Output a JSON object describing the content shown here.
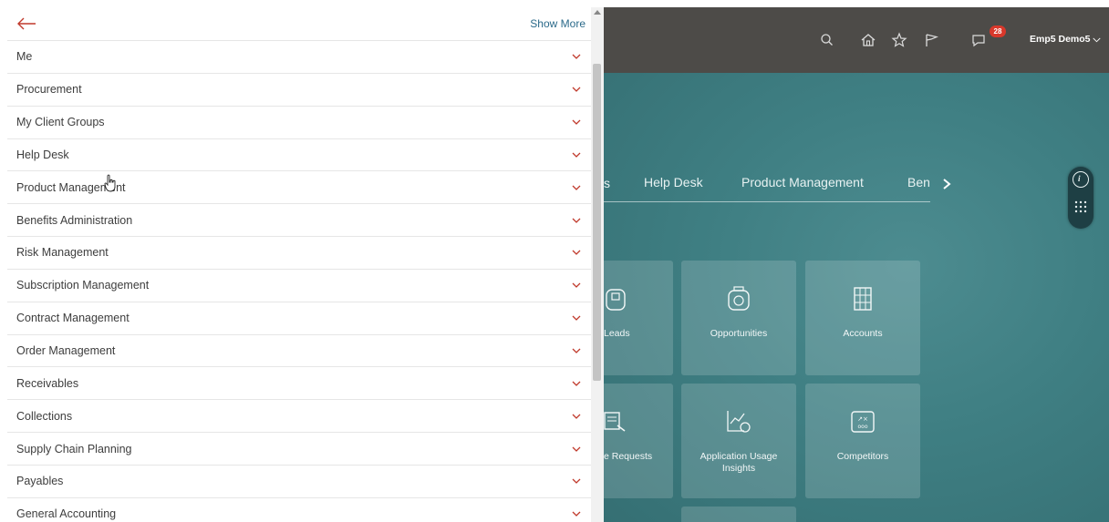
{
  "drawer": {
    "show_more_label": "Show More",
    "items": [
      {
        "label": "Me"
      },
      {
        "label": "Procurement"
      },
      {
        "label": "My Client Groups"
      },
      {
        "label": "Help Desk"
      },
      {
        "label": "Product Management"
      },
      {
        "label": "Benefits Administration"
      },
      {
        "label": "Risk Management"
      },
      {
        "label": "Subscription Management"
      },
      {
        "label": "Contract Management"
      },
      {
        "label": "Order Management"
      },
      {
        "label": "Receivables"
      },
      {
        "label": "Collections"
      },
      {
        "label": "Supply Chain Planning"
      },
      {
        "label": "Payables"
      },
      {
        "label": "General Accounting"
      }
    ]
  },
  "header": {
    "notification_count": "28",
    "user_name": "Emp5 Demo5"
  },
  "tabs": [
    {
      "label": "Help Desk"
    },
    {
      "label": "Product Management"
    },
    {
      "label": "Ben"
    }
  ],
  "tiles": [
    {
      "label": "Leads",
      "icon": "leads-icon"
    },
    {
      "label": "Opportunities",
      "icon": "opportunities-icon"
    },
    {
      "label": "Accounts",
      "icon": "accounts-icon"
    },
    {
      "label": "e Requests",
      "icon": "service-requests-icon"
    },
    {
      "label": "Application Usage Insights",
      "icon": "usage-insights-icon"
    },
    {
      "label": "Competitors",
      "icon": "competitors-icon"
    }
  ],
  "colors": {
    "topbar": "#4d4b48",
    "background": "#3f7f83",
    "accent_link": "#2b6a8a",
    "chevron": "#c0392b",
    "badge": "#d9382b"
  }
}
